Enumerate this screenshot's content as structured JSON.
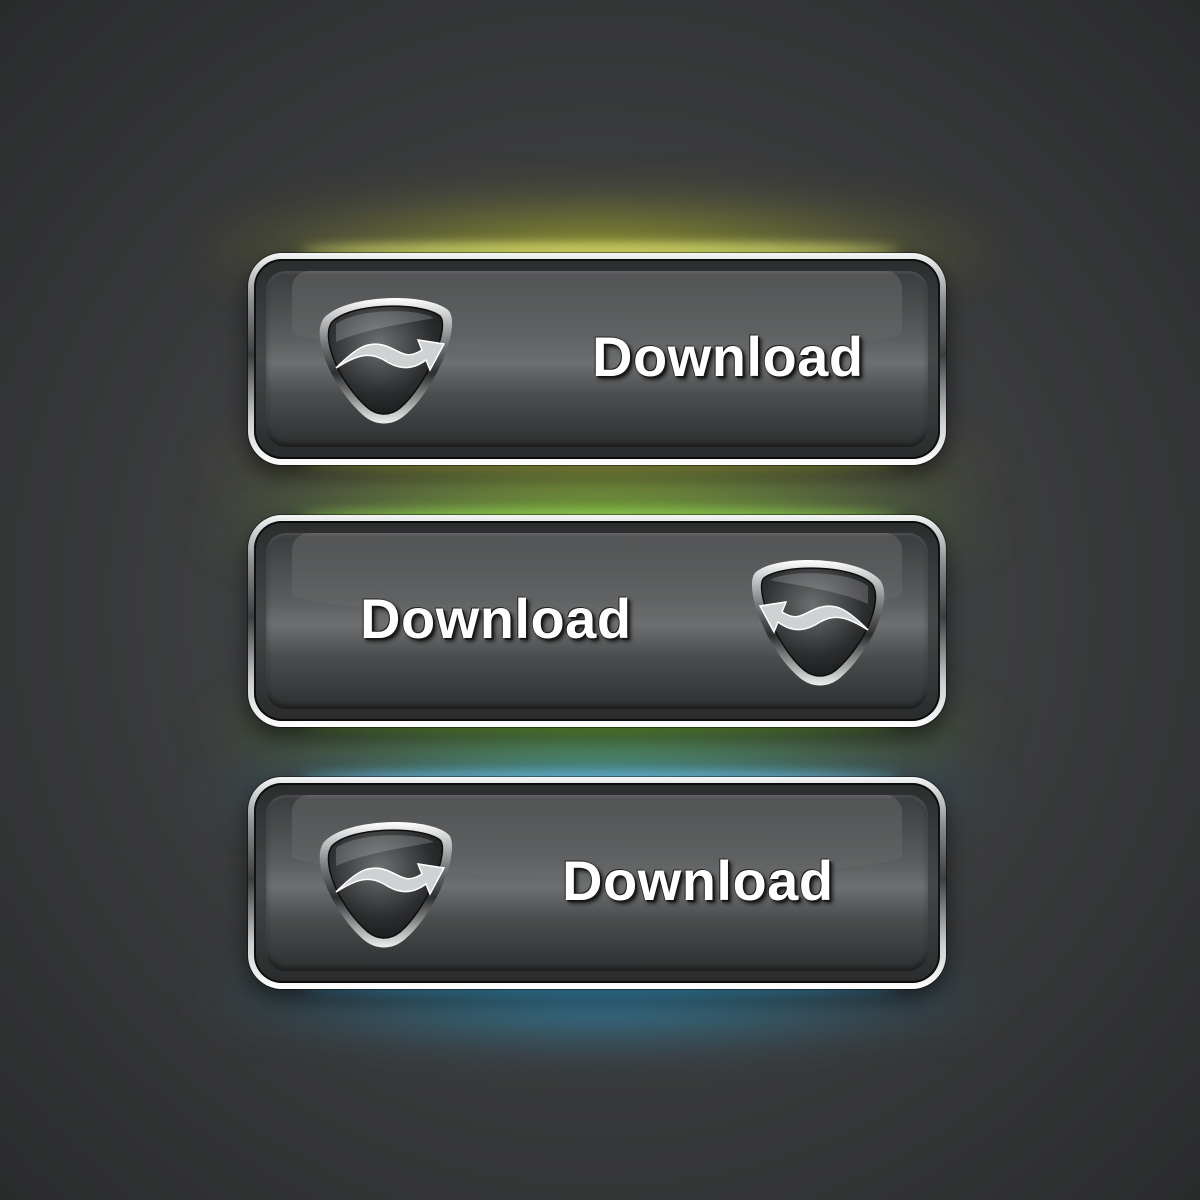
{
  "buttons": [
    {
      "label": "Download",
      "glow_color": "#d8e21a",
      "icon": "download-arrow-icon",
      "icon_side": "left"
    },
    {
      "label": "Download",
      "glow_color": "#6fd11c",
      "icon": "download-arrow-icon",
      "icon_side": "right"
    },
    {
      "label": "Download",
      "glow_color": "#2aaee8",
      "icon": "download-arrow-icon",
      "icon_side": "left"
    }
  ],
  "colors": {
    "background": "#3d3e3f",
    "button_face": "#5a5c5d",
    "frame": "#c9cccd",
    "label_text": "#ffffff"
  }
}
